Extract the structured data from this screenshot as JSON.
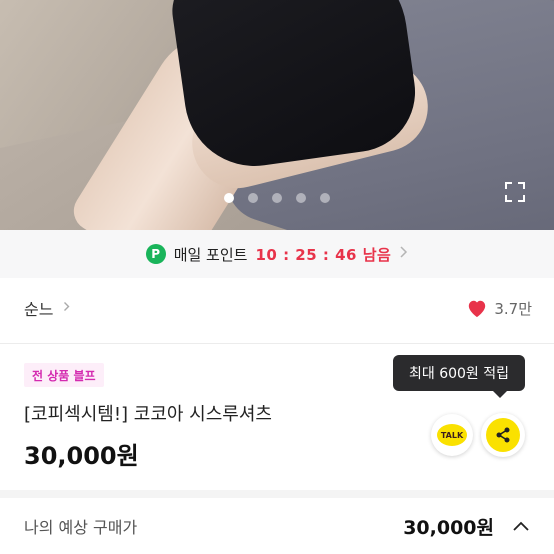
{
  "gallery": {
    "slide_count": 5,
    "active_index": 0,
    "expand_icon": "expand-icon"
  },
  "points": {
    "icon_letter": "P",
    "label": "매일 포인트",
    "timer": "10 : 25 : 46 남음",
    "accent_color": "#e8334a"
  },
  "seller": {
    "name": "순느",
    "likes": "3.7만"
  },
  "product": {
    "badge": "전 상품 블프",
    "title": "[코피섹시템!] 코코아 시스루셔츠",
    "price": "30,000원"
  },
  "reward_tooltip": "최대 600원 적립",
  "share": {
    "talk_label": "TALK"
  },
  "expected": {
    "label": "나의 예상 구매가",
    "price": "30,000원"
  }
}
